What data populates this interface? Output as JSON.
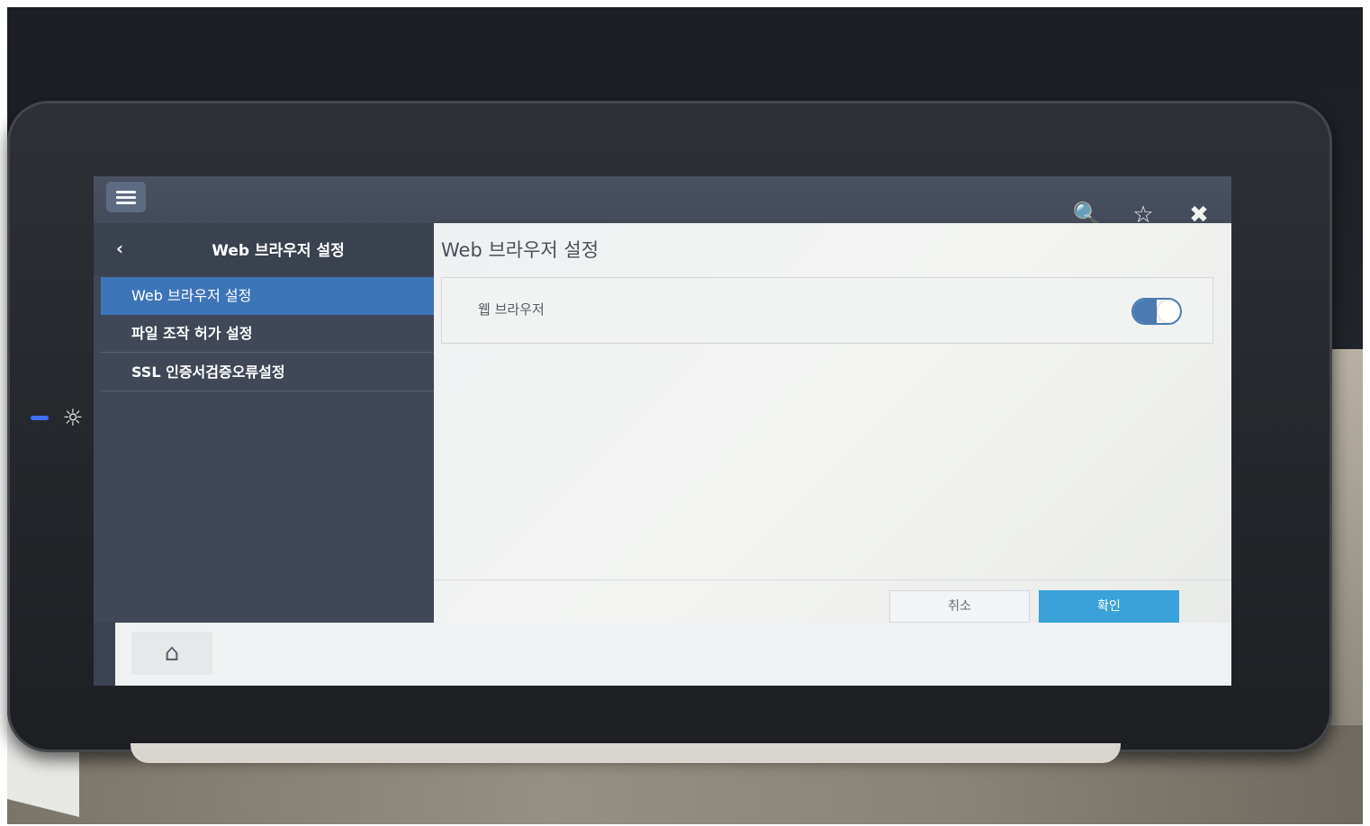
{
  "topbar": {
    "menu_icon": "hamburger-menu-icon",
    "search_icon": "🔍",
    "favorite_icon": "☆",
    "close_icon": "✖"
  },
  "sidebar": {
    "back_icon": "‹",
    "title": "Web 브라우저 설정",
    "items": [
      {
        "label": "Web 브라우저 설정",
        "active": true
      },
      {
        "label": "파일 조작 허가 설정",
        "active": false
      },
      {
        "label": "SSL 인증서검증오류설정",
        "active": false
      }
    ]
  },
  "main": {
    "title": "Web 브라우저 설정",
    "setting_label": "웹 브라우저",
    "toggle_state": "on"
  },
  "buttons": {
    "cancel_label": "취소",
    "ok_label": "확인"
  },
  "bottombar": {
    "home_icon": "⌂"
  },
  "colors": {
    "active_item": "#3d74b8",
    "ok_button": "#3aa2d8",
    "toggle": "#4a7bb0"
  }
}
